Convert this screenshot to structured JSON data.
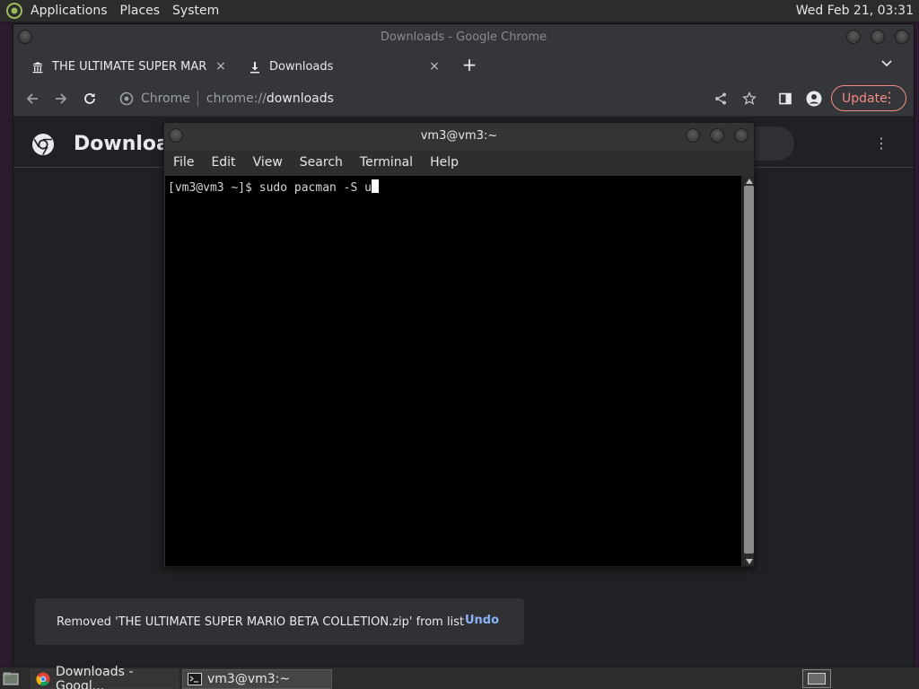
{
  "top_panel": {
    "menus": [
      "Applications",
      "Places",
      "System"
    ],
    "clock": "Wed Feb 21, 03:31"
  },
  "chrome": {
    "window_title": "Downloads - Google Chrome",
    "tabs": [
      {
        "title": "THE ULTIMATE SUPER MARIO",
        "icon": "museum-icon",
        "close": "×"
      },
      {
        "title": "Downloads",
        "icon": "download-icon",
        "close": "×"
      }
    ],
    "new_tab": "+",
    "omnibox": {
      "label": "Chrome",
      "scheme": "chrome://",
      "host": "downloads"
    },
    "update_label": "Update",
    "page_title": "Downloads",
    "toast": {
      "message": "Removed 'THE ULTIMATE SUPER MARIO BETA COLLETION.zip' from list",
      "action": "Undo"
    }
  },
  "terminal": {
    "title": "vm3@vm3:~",
    "menus": [
      "File",
      "Edit",
      "View",
      "Search",
      "Terminal",
      "Help"
    ],
    "prompt": "[vm3@vm3 ~]$ ",
    "command": "sudo pacman -S u"
  },
  "taskbar": {
    "tasks": [
      {
        "label": "Downloads - Googl...",
        "icon": "chrome-icon"
      },
      {
        "label": "vm3@vm3:~",
        "icon": "terminal-icon"
      }
    ]
  },
  "colors": {
    "accent_link": "#8ab4f8",
    "update_accent": "#f28b82",
    "terminal_bg": "#000000"
  }
}
